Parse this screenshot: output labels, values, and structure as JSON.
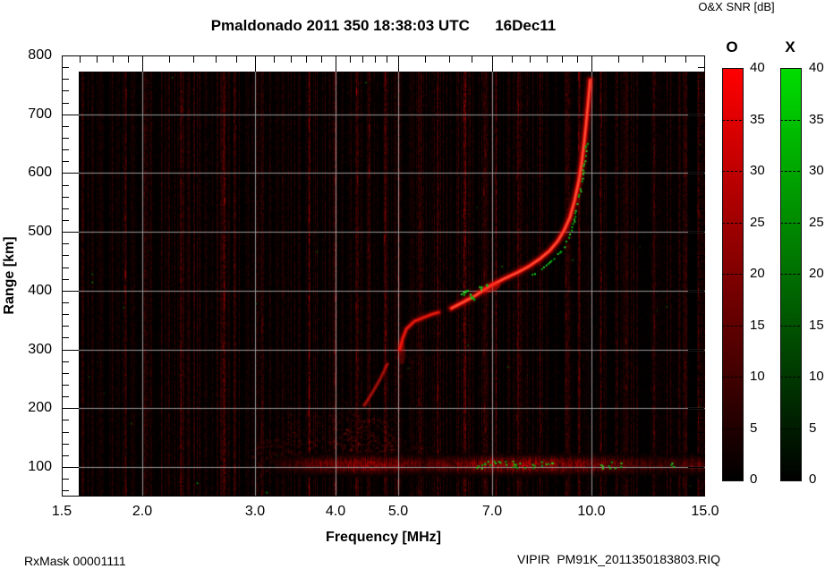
{
  "header": {
    "title": "Pmaldonado 2011 350 18:38:03 UTC      16Dec11",
    "colorbar_title": "O&X SNR [dB]"
  },
  "footer": {
    "left": "RxMask 00001111",
    "right": "VIPIR  PM91K_2011350183803.RIQ"
  },
  "chart_data": {
    "type": "heatmap",
    "title": "Pmaldonado 2011 350 18:38:03 UTC      16Dec11",
    "xlabel": "Frequency [MHz]",
    "ylabel": "Range [km]",
    "x_scale": "log",
    "xlim": [
      1.5,
      15
    ],
    "ylim": [
      50,
      800
    ],
    "grid": true,
    "x_major_ticks": [
      1.5,
      2,
      3,
      4,
      5,
      7,
      10,
      15
    ],
    "x_tick_labels": [
      "1.5",
      "2.0",
      "3.0",
      "4.0",
      "5.0",
      "7.0",
      "10.0",
      "15.0"
    ],
    "x_minor_ticks": [
      1.6,
      1.7,
      1.8,
      1.9,
      2.2,
      2.4,
      2.6,
      2.8,
      3.2,
      3.4,
      3.6,
      3.8,
      4.2,
      4.4,
      4.6,
      4.8,
      5.5,
      6.0,
      6.5,
      7.5,
      8.0,
      8.5,
      9.0,
      9.5,
      11,
      12,
      13,
      14
    ],
    "y_major_ticks": [
      100,
      200,
      300,
      400,
      500,
      600,
      700,
      800
    ],
    "y_minor_step_km": 20,
    "grid_x": [
      2,
      3,
      4,
      5,
      7,
      10
    ],
    "grid_y": [
      100,
      200,
      300,
      400,
      500,
      600,
      700
    ],
    "background_color": "#000000",
    "grid_color": "#999999",
    "colorbars": [
      {
        "label": "O",
        "units": "dB",
        "min": 0,
        "max": 40,
        "top_color": "#ff0000",
        "bottom_color": "#000000",
        "ticks": [
          40,
          35,
          30,
          25,
          20,
          15,
          10,
          5,
          0
        ]
      },
      {
        "label": "X",
        "units": "dB",
        "min": 0,
        "max": 40,
        "top_color": "#00dd00",
        "bottom_color": "#000000",
        "ticks": [
          40,
          35,
          30,
          25,
          20,
          15,
          10,
          5,
          0
        ]
      }
    ],
    "series": [
      {
        "name": "O-mode F-layer trace (main)",
        "color": "#ff2015",
        "units": "MHz,km",
        "points": [
          [
            6.05,
            370
          ],
          [
            6.3,
            380
          ],
          [
            6.6,
            392
          ],
          [
            6.95,
            408
          ],
          [
            7.3,
            420
          ],
          [
            7.7,
            432
          ],
          [
            8.0,
            442
          ],
          [
            8.3,
            454
          ],
          [
            8.6,
            468
          ],
          [
            8.85,
            484
          ],
          [
            9.05,
            502
          ],
          [
            9.25,
            525
          ],
          [
            9.4,
            553
          ],
          [
            9.55,
            588
          ],
          [
            9.65,
            620
          ],
          [
            9.73,
            652
          ],
          [
            9.8,
            685
          ],
          [
            9.86,
            715
          ],
          [
            9.91,
            742
          ],
          [
            9.94,
            758
          ]
        ]
      },
      {
        "name": "O-mode F-layer trace (lower cusp)",
        "color": "#ff2015",
        "points": [
          [
            5.03,
            300
          ],
          [
            5.08,
            318
          ],
          [
            5.15,
            335
          ],
          [
            5.3,
            348
          ],
          [
            5.5,
            355
          ],
          [
            5.65,
            360
          ],
          [
            5.78,
            363
          ]
        ]
      },
      {
        "name": "O-mode oblique segment",
        "color": "#d01a10",
        "points": [
          [
            4.43,
            205
          ],
          [
            4.55,
            225
          ],
          [
            4.68,
            248
          ],
          [
            4.81,
            275
          ]
        ]
      },
      {
        "name": "X-mode trace",
        "color": "#00cc22",
        "points": [
          [
            8.05,
            428
          ],
          [
            8.4,
            442
          ],
          [
            8.7,
            456
          ],
          [
            9.0,
            472
          ],
          [
            9.2,
            492
          ],
          [
            9.35,
            514
          ],
          [
            9.5,
            552
          ],
          [
            9.62,
            584
          ],
          [
            9.7,
            612
          ],
          [
            9.76,
            638
          ],
          [
            9.82,
            662
          ]
        ]
      },
      {
        "name": "X-mode clusters",
        "color": "#00cc22",
        "points": [
          [
            6.28,
            396
          ],
          [
            6.36,
            400
          ],
          [
            6.45,
            392
          ],
          [
            6.52,
            388
          ],
          [
            6.72,
            406
          ],
          [
            6.82,
            410
          ]
        ]
      }
    ],
    "e_band": {
      "range_km": 105,
      "f_start": 3.2,
      "f_end": 15,
      "envelope": [
        [
          3.2,
          0.12
        ],
        [
          3.8,
          0.35
        ],
        [
          4.3,
          0.5
        ],
        [
          4.8,
          0.45
        ],
        [
          5.4,
          0.3
        ],
        [
          6.2,
          0.35
        ],
        [
          6.8,
          0.5
        ],
        [
          7.6,
          0.55
        ],
        [
          8.6,
          0.5
        ],
        [
          9.6,
          0.45
        ],
        [
          10.5,
          0.4
        ],
        [
          11.5,
          0.28
        ],
        [
          12.5,
          0.22
        ],
        [
          13.5,
          0.22
        ],
        [
          14.5,
          0.3
        ],
        [
          15,
          0.3
        ]
      ],
      "green_clusters": [
        {
          "f1": 6.6,
          "f2": 7.9,
          "r1": 98,
          "r2": 112,
          "n": 22
        },
        {
          "f1": 8.05,
          "f2": 8.85,
          "r1": 98,
          "r2": 110,
          "n": 9
        },
        {
          "f1": 10.3,
          "f2": 11.25,
          "r1": 98,
          "r2": 110,
          "n": 9
        },
        {
          "f1": 13.2,
          "f2": 13.45,
          "r1": 100,
          "r2": 108,
          "n": 3
        }
      ]
    },
    "diffuse_patches": [
      {
        "f1": 2.95,
        "f2": 4.1,
        "r1": 92,
        "r2": 150,
        "a": 0.22
      },
      {
        "f1": 3.35,
        "f2": 4.05,
        "r1": 150,
        "r2": 195,
        "a": 0.18
      },
      {
        "f1": 4.1,
        "f2": 4.9,
        "r1": 92,
        "r2": 185,
        "a": 0.3
      },
      {
        "f1": 4.05,
        "f2": 4.35,
        "r1": 185,
        "r2": 215,
        "a": 0.15
      },
      {
        "f1": 5.0,
        "f2": 5.55,
        "r1": 95,
        "r2": 145,
        "a": 0.18
      },
      {
        "f1": 4.95,
        "f2": 5.25,
        "r1": 240,
        "r2": 310,
        "a": 0.12
      }
    ],
    "rfi_stripes_mhz": [
      {
        "f": 1.88,
        "s": 0.35
      },
      {
        "f": 2.3,
        "s": 0.3
      },
      {
        "f": 2.68,
        "s": 0.5
      },
      {
        "f": 2.78,
        "s": 0.35
      },
      {
        "f": 3.06,
        "s": 0.3
      },
      {
        "f": 3.63,
        "s": 0.45
      },
      {
        "f": 3.99,
        "s": 0.5
      },
      {
        "f": 4.3,
        "s": 0.45
      },
      {
        "f": 4.5,
        "s": 0.4
      },
      {
        "f": 4.77,
        "s": 0.5
      },
      {
        "f": 5.0,
        "s": 0.45
      },
      {
        "f": 5.4,
        "s": 0.35
      },
      {
        "f": 5.76,
        "s": 0.4
      },
      {
        "f": 6.33,
        "s": 0.6
      },
      {
        "f": 6.8,
        "s": 0.35
      },
      {
        "f": 7.1,
        "s": 0.3
      },
      {
        "f": 7.65,
        "s": 0.35
      },
      {
        "f": 8.3,
        "s": 0.3
      },
      {
        "f": 9.1,
        "s": 0.3
      },
      {
        "f": 9.55,
        "s": 0.5
      },
      {
        "f": 10.3,
        "s": 0.4
      },
      {
        "f": 11.3,
        "s": 0.35
      },
      {
        "f": 12.5,
        "s": 0.3
      },
      {
        "f": 13.9,
        "s": 0.3
      },
      {
        "f": 14.6,
        "s": 0.25
      }
    ]
  }
}
